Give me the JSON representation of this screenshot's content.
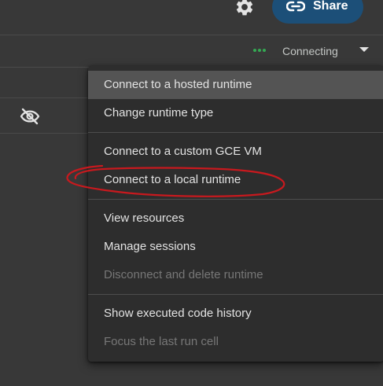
{
  "header": {
    "settings_icon": "gear-icon",
    "share_label": "Share",
    "share_icon": "link-icon",
    "share_color": "#1c4f78"
  },
  "runtime": {
    "status_label": "Connecting",
    "status_indicator_color": "#34a853",
    "dropdown_icon": "caret-down-icon"
  },
  "side_icon": "eye-off-icon",
  "menu": {
    "sections": [
      {
        "items": [
          {
            "label": "Connect to a hosted runtime",
            "state": "hover"
          },
          {
            "label": "Change runtime type",
            "state": "enabled"
          }
        ]
      },
      {
        "items": [
          {
            "label": "Connect to a custom GCE VM",
            "state": "enabled"
          },
          {
            "label": "Connect to a local runtime",
            "state": "enabled",
            "annotated": true
          }
        ]
      },
      {
        "items": [
          {
            "label": "View resources",
            "state": "enabled"
          },
          {
            "label": "Manage sessions",
            "state": "enabled"
          },
          {
            "label": "Disconnect and delete runtime",
            "state": "disabled"
          }
        ]
      },
      {
        "items": [
          {
            "label": "Show executed code history",
            "state": "enabled"
          },
          {
            "label": "Focus the last run cell",
            "state": "disabled"
          }
        ]
      }
    ]
  },
  "annotation_color": "#c8191e"
}
